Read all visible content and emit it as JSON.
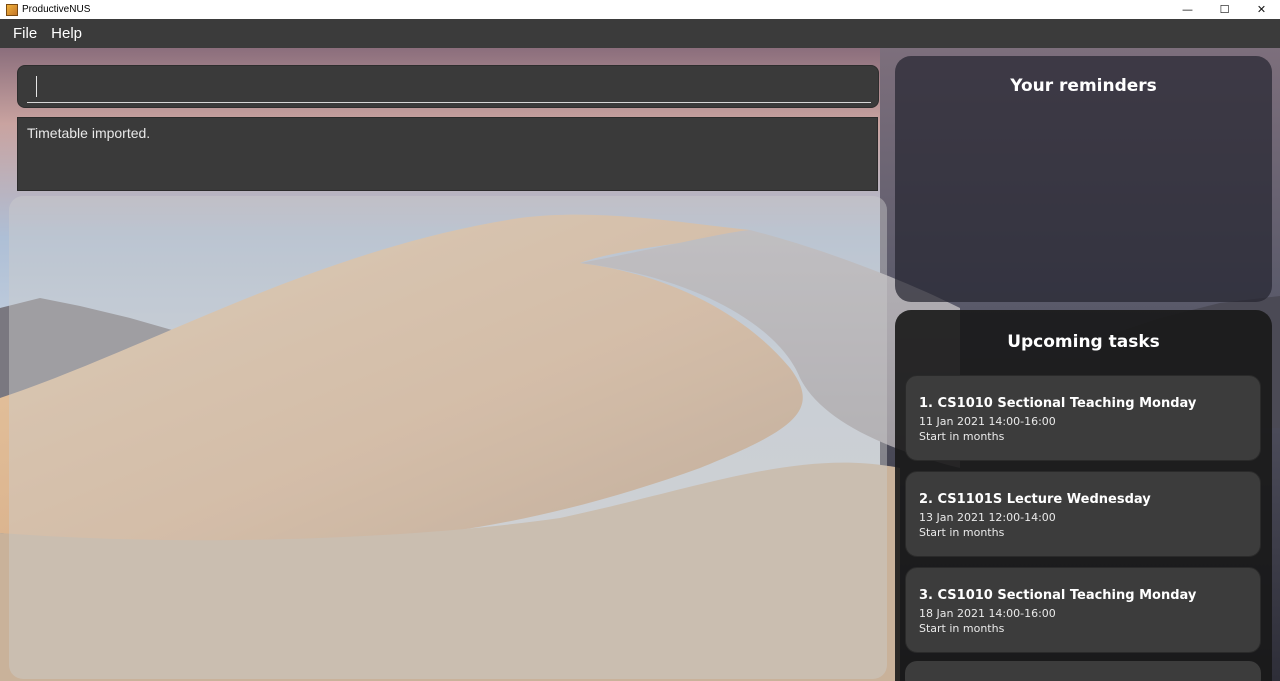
{
  "window": {
    "title": "ProductiveNUS",
    "controls": {
      "minimize": "—",
      "maximize": "☐",
      "close": "✕"
    }
  },
  "menu": [
    {
      "label": "File"
    },
    {
      "label": "Help"
    }
  ],
  "command": {
    "value": "",
    "placeholder": ""
  },
  "result": {
    "message": "Timetable imported."
  },
  "reminders": {
    "title": "Your reminders"
  },
  "tasks": {
    "title": "Upcoming tasks",
    "items": [
      {
        "name": "1.  CS1010 Sectional Teaching Monday",
        "date": "11 Jan 2021 14:00-16:00",
        "status": "Start in months"
      },
      {
        "name": "2.  CS1101S Lecture Wednesday",
        "date": "13 Jan 2021 12:00-14:00",
        "status": "Start in months"
      },
      {
        "name": "3.  CS1010 Sectional Teaching Monday",
        "date": "18 Jan 2021 14:00-16:00",
        "status": "Start in months"
      }
    ]
  },
  "colors": {
    "menubar": "#3b3b3b",
    "panel": "#3a3a3a",
    "task_card": "#3c3c3c",
    "text": "#ffffff"
  }
}
